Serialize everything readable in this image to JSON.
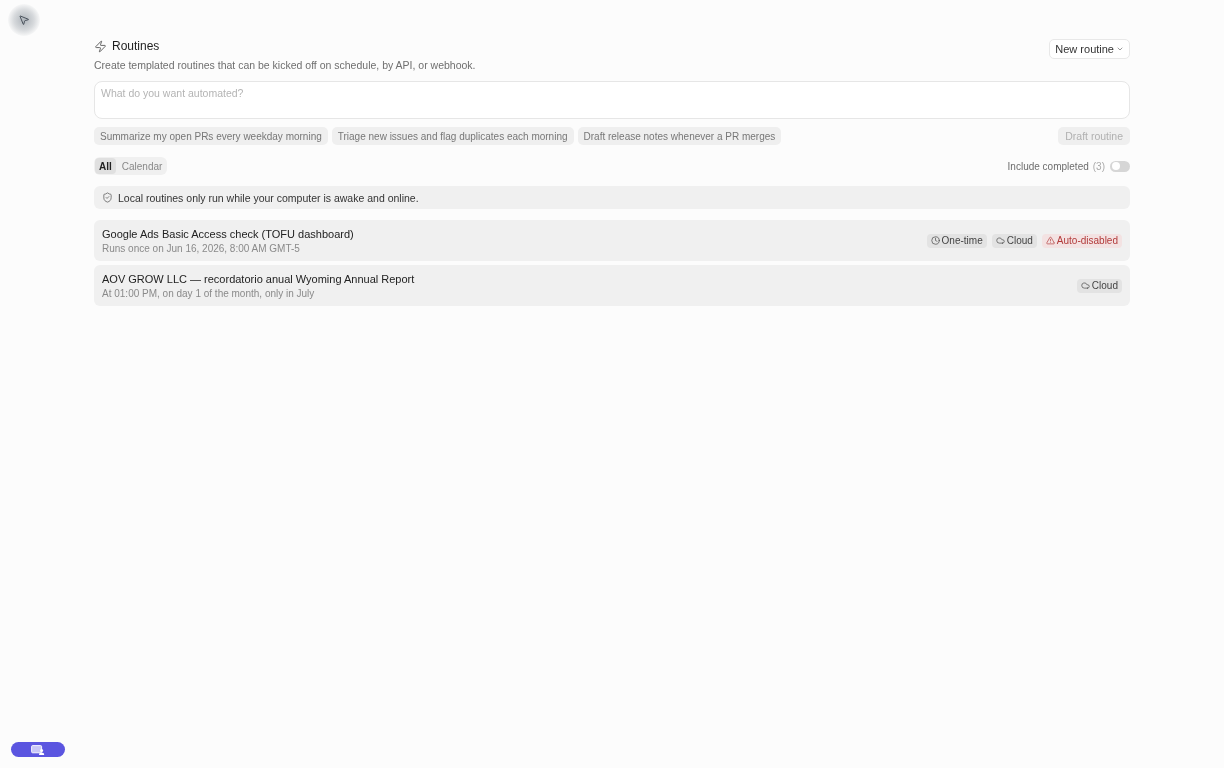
{
  "header": {
    "title": "Routines",
    "subtitle": "Create templated routines that can be kicked off on schedule, by API, or webhook.",
    "new_button": "New routine"
  },
  "prompt": {
    "placeholder": "What do you want automated?"
  },
  "suggestions": [
    "Summarize my open PRs every weekday morning",
    "Triage new issues and flag duplicates each morning",
    "Draft release notes whenever a PR merges"
  ],
  "draft_button": {
    "label": "Draft routine",
    "disabled": true
  },
  "filters": [
    {
      "label": "All",
      "selected": true
    },
    {
      "label": "Calendar",
      "selected": false
    }
  ],
  "include_completed": {
    "label": "Include completed",
    "count": "(3)",
    "on": false
  },
  "notice": "Local routines only run while your computer is awake and online.",
  "routines": [
    {
      "title": "Google Ads Basic Access check (TOFU dashboard)",
      "schedule": "Runs once on Jun 16, 2026, 8:00 AM GMT-5",
      "tags": [
        {
          "kind": "one-time",
          "label": "One-time"
        },
        {
          "kind": "cloud",
          "label": "Cloud"
        },
        {
          "kind": "warning",
          "label": "Auto-disabled"
        }
      ]
    },
    {
      "title": "AOV GROW LLC — recordatorio anual Wyoming Annual Report",
      "schedule": "At 01:00 PM, on day 1 of the month, only in July",
      "tags": [
        {
          "kind": "cloud",
          "label": "Cloud"
        }
      ]
    }
  ]
}
